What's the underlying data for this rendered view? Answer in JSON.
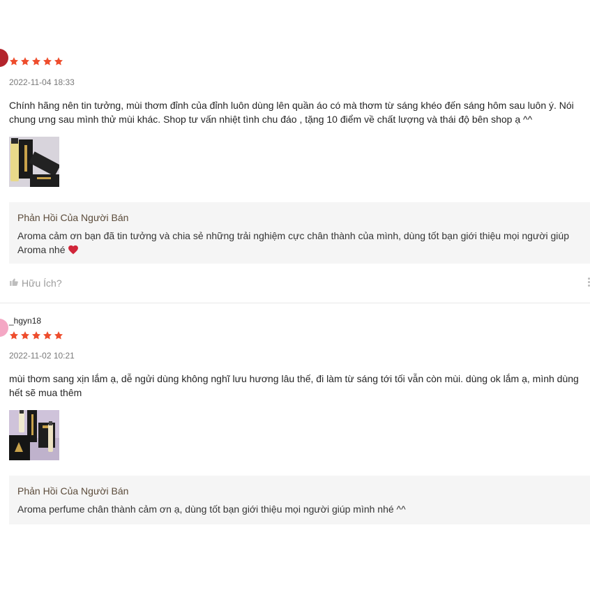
{
  "colors": {
    "star": "#ee4d2d",
    "reply_bg": "#f5f5f5",
    "heart": "#d1263a"
  },
  "reviews": [
    {
      "username": "",
      "rating": 5,
      "date": "2022-11-04 18:33",
      "content": "Chính hãng nên tin tưởng, mùi thơm đỉnh của đỉnh luôn dùng lên quần áo có mà thơm từ sáng khéo đến sáng hôm sau luôn ý. Nói chung ưng sau mình thử mùi khác. Shop tư vấn nhiệt tình chu đáo , tặng 10 điểm về chất lượng và thái độ bên shop ạ ^^",
      "reply_title": "Phản Hồi Của Người Bán",
      "reply_text": "Aroma cảm ơn bạn đã tin tưởng và chia sẻ những trải nghiệm cực chân thành của mình, dùng tốt bạn giới thiệu mọi người giúp Aroma nhé",
      "reply_icon": "heart-icon",
      "helpful_label": "Hữu Ích?"
    },
    {
      "username": "_hgyn18",
      "rating": 5,
      "date": "2022-11-02 10:21",
      "content": "mùi thơm sang xịn lắm ạ, dễ ngửi dùng không nghĩ lưu hương lâu thế, đi làm từ sáng tới tối vẫn còn mùi. dùng ok lắm ạ, mình dùng hết sẽ mua thêm",
      "reply_title": "Phản Hồi Của Người Bán",
      "reply_text": "Aroma perfume chân thành cảm ơn ạ, dùng tốt bạn giới thiệu mọi người giúp mình nhé ^^"
    }
  ]
}
